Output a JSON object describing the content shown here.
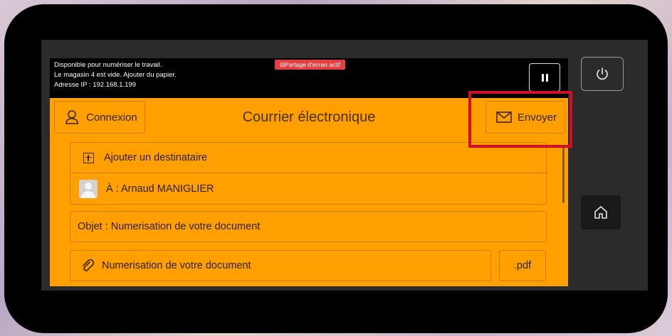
{
  "status": {
    "line1": "Disponible pour numériser le travail.",
    "line2": "Le magasin 4 est vide.  Ajouter du papier.",
    "line3": "Adresse IP : 192.168.1.199",
    "share_badge": "⊟Partage d'écran actif"
  },
  "header": {
    "connexion_label": "Connexion",
    "title": "Courrier électronique",
    "send_label": "Envoyer"
  },
  "form": {
    "add_recipient": "Ajouter un destinataire",
    "recipient": "À : Arnaud MANIGLIER",
    "subject": "Objet : Numerisation de votre document",
    "attachment_name": "Numerisation de votre document",
    "attachment_ext": ".pdf"
  },
  "colors": {
    "panel": "#ffa000",
    "highlight": "#d0102a",
    "share_badge": "#e53f3f"
  },
  "icons": [
    "user-icon",
    "envelope-icon",
    "plus-box-icon",
    "avatar-icon",
    "paperclip-icon",
    "pause-icon",
    "power-icon",
    "home-icon"
  ]
}
